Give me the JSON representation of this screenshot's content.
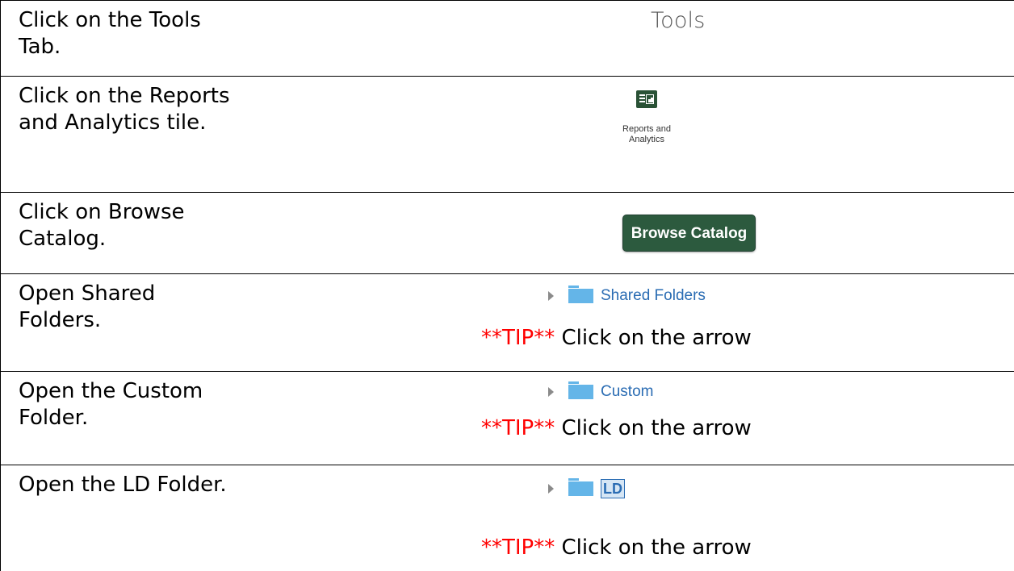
{
  "steps": [
    {
      "text": "Click on the Tools\nTab.",
      "visual": {
        "label": "Tools"
      }
    },
    {
      "text": "Click on the Reports\nand Analytics tile.",
      "visual": {
        "caption": "Reports and\nAnalytics",
        "icon": "report-analytics-icon"
      }
    },
    {
      "text": "Click on Browse\nCatalog.",
      "visual": {
        "button_label": "Browse Catalog"
      }
    },
    {
      "text": "Open Shared\nFolders.",
      "visual": {
        "folder_label": "Shared Folders",
        "tip_marker": "**TIP**",
        "tip_text": " Click on the arrow"
      }
    },
    {
      "text": "Open the Custom\nFolder.",
      "visual": {
        "folder_label": "Custom",
        "tip_marker": "**TIP**",
        "tip_text": " Click on the arrow"
      }
    },
    {
      "text": "Open the LD Folder.",
      "visual": {
        "folder_label": "LD",
        "tip_marker": "**TIP**",
        "tip_text": " Click on the arrow"
      }
    }
  ],
  "colors": {
    "tile_green": "#2a5236",
    "button_green": "#2c5a3e",
    "folder_blue": "#64b5e8",
    "link_blue": "#2a6cb3",
    "tip_red": "#ff0000"
  }
}
